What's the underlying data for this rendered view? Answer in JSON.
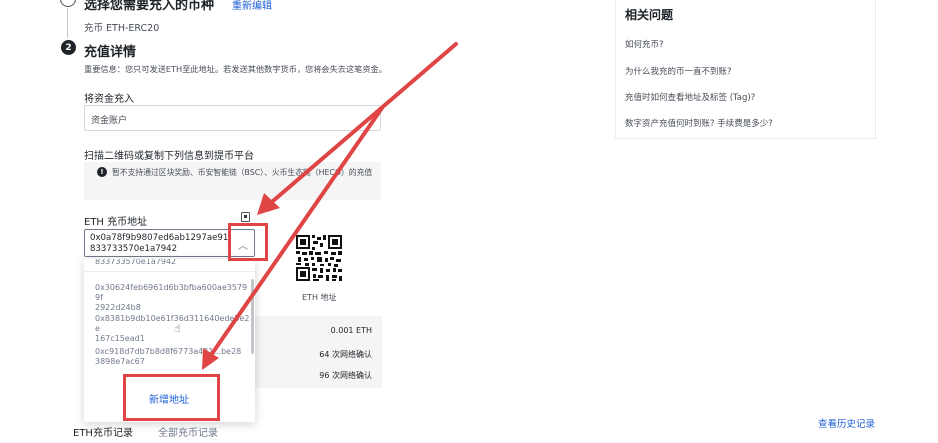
{
  "step1": {
    "title": "选择您需要充入的币种",
    "edit_link": "重新编辑",
    "selected_coin": "充币 ETH-ERC20"
  },
  "step2": {
    "number": "2",
    "title": "充值详情",
    "notice": "重要信息：您只可发送ETH至此地址。若发送其他数字货币，您将会失去这笔资金。"
  },
  "deposit_to": {
    "label": "将资金充入",
    "value": "资金账户"
  },
  "scan_label": "扫描二维码或复制下列信息到提币平台",
  "warning": {
    "icon": "info-icon",
    "text": "暂不支持通过区块奖励、币安智能链（BSC）、火币生态链（HECO）的充值"
  },
  "address": {
    "label": "ETH 充币地址",
    "value": "0x0a78f9b9807ed6ab1297ae91833733570e1a7942",
    "line1": "0x0a78f9b9807ed6ab1297ae91",
    "line2": "833733570e1a7942"
  },
  "qr": {
    "caption": "ETH 地址"
  },
  "dropdown": {
    "partial_top": "833733570e1a7942",
    "options": [
      {
        "line1": "0x30624feb6961d6b3bfba600ae35799f",
        "line2": "2922d24b8"
      },
      {
        "line1": "0x8381b9db10e61f36d311640ede5e2e",
        "line2": "167c15ead1"
      },
      {
        "line1": "0xc918d7db7b8d8f6773a421...be28",
        "line2": "3898e7ac67"
      }
    ],
    "add_button": "新增地址"
  },
  "details": {
    "min_deposit": "0.001 ETH",
    "credit_confirm": "64 次网络确认",
    "unlock_confirm": "96 次网络确认"
  },
  "related": {
    "title": "相关问题",
    "items": [
      "如何充币?",
      "为什么我充的币一直不到账?",
      "充值时如何查看地址及标签 (Tag)?",
      "数字资产充值何时到账? 手续费是多少?"
    ]
  },
  "tabs": {
    "eth_records": "ETH充币记录",
    "all_records": "全部充币记录"
  },
  "history_link": "查看历史记录",
  "colors": {
    "accent_blue": "#1c5ed6",
    "annotation_red": "#e04545",
    "panel_gray": "#f5f5f5"
  }
}
